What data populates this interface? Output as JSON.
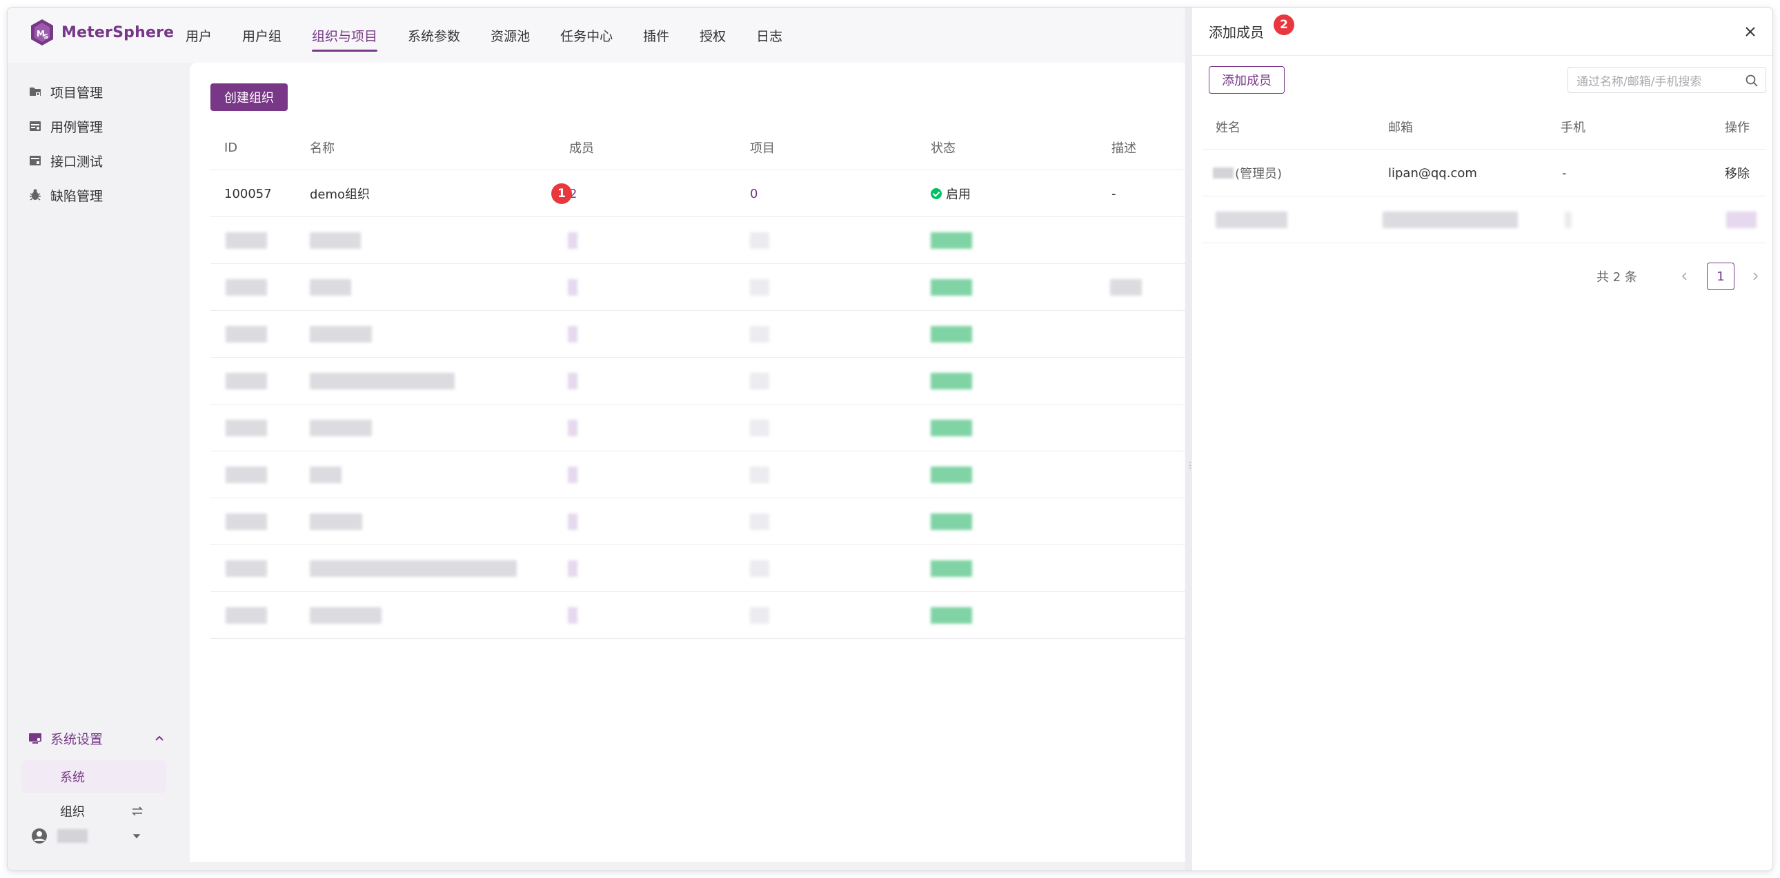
{
  "app": {
    "logo_text": "MeterSphere",
    "brand_color": "#783887"
  },
  "nav": {
    "items": [
      "用户",
      "用户组",
      "组织与项目",
      "系统参数",
      "资源池",
      "任务中心",
      "插件",
      "授权",
      "日志"
    ],
    "active": "组织与项目"
  },
  "sidebar": {
    "items": [
      {
        "label": "项目管理",
        "icon": "project-folder-icon"
      },
      {
        "label": "用例管理",
        "icon": "case-management-icon"
      },
      {
        "label": "接口测试",
        "icon": "api-test-icon"
      },
      {
        "label": "缺陷管理",
        "icon": "bug-icon"
      }
    ],
    "settings_label": "系统设置",
    "sub_system": "系统",
    "sub_org": "组织"
  },
  "main": {
    "create_button": "创建组织",
    "columns": [
      "ID",
      "名称",
      "成员",
      "项目",
      "状态",
      "描述"
    ],
    "first_row": {
      "id": "100057",
      "name": "demo组织",
      "members": "2",
      "projects": "0",
      "status": "启用",
      "desc": "-"
    },
    "badge_1": "1",
    "status_color": "#00c261"
  },
  "drawer": {
    "title": "添加成员",
    "badge_2": "2",
    "add_button": "添加成员",
    "search_placeholder": "通过名称/邮箱/手机搜索",
    "columns": [
      "姓名",
      "邮箱",
      "手机",
      "操作"
    ],
    "row1": {
      "name_suffix": "(管理员)",
      "email": "lipan@qq.com",
      "phone": "-",
      "action": "移除"
    },
    "total": "共 2 条",
    "page": "1"
  }
}
